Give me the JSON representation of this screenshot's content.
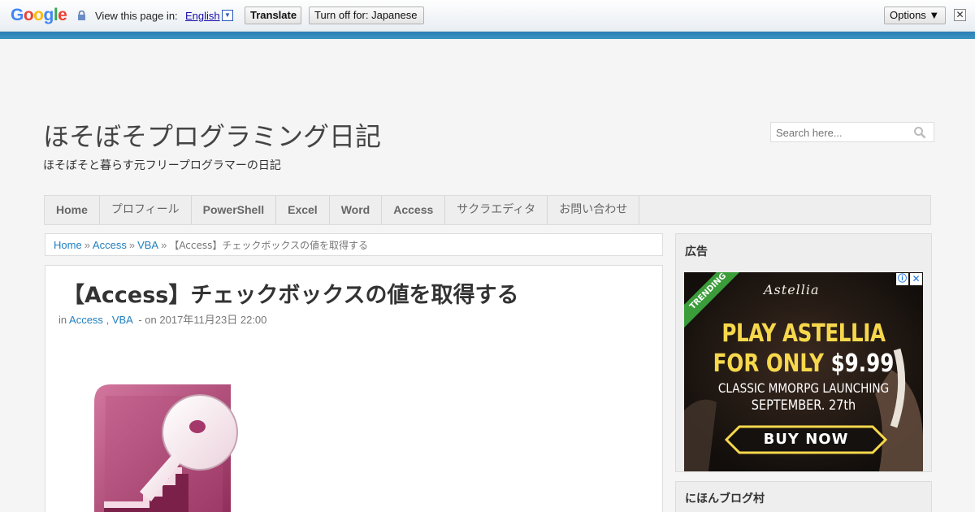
{
  "translate_bar": {
    "logo": "Google",
    "view_label": "View this page in:",
    "language": "English",
    "language_arrow": "▼",
    "translate_button": "Translate",
    "turn_off_button": "Turn off for: Japanese",
    "options_button": "Options ▼",
    "close_glyph": "✕"
  },
  "site": {
    "title": "ほそぼそプログラミング日記",
    "description": "ほそぼそと暮らす元フリープログラマーの日記"
  },
  "search": {
    "placeholder": "Search here..."
  },
  "nav": {
    "items": [
      {
        "label": "Home"
      },
      {
        "label": "プロフィール"
      },
      {
        "label": "PowerShell"
      },
      {
        "label": "Excel"
      },
      {
        "label": "Word"
      },
      {
        "label": "Access"
      },
      {
        "label": "サクラエディタ"
      },
      {
        "label": "お問い合わせ"
      }
    ]
  },
  "breadcrumb": {
    "items": [
      "Home",
      "Access",
      "VBA"
    ],
    "separator": "»",
    "current": "【Access】チェックボックスの値を取得する"
  },
  "post": {
    "title": "【Access】チェックボックスの値を取得する",
    "meta_prefix": "in",
    "categories": [
      "Access",
      "VBA"
    ],
    "category_sep": ",",
    "date_prefix": "- on",
    "date": "2017年11月23日 22:00"
  },
  "sidebar": {
    "ad_widget_title": "広告",
    "nihon_widget_title": "にほんブログ村"
  },
  "ad": {
    "ribbon": "TRENDING",
    "logo": "Astellia",
    "line1": "PLAY ASTELLIA",
    "line2_a": "FOR ONLY",
    "line2_b": "$9.99",
    "line3": "CLASSIC MMORPG LAUNCHING",
    "line4": "SEPTEMBER. 27th",
    "cta": "BUY NOW",
    "info_glyph": "ⓘ",
    "close_glyph": "✕"
  },
  "colors": {
    "stripe": "#2d7fb5",
    "link": "#1f7fbf",
    "ad_yellow": "#f7d84c",
    "access_magenta": "#a5386b"
  }
}
